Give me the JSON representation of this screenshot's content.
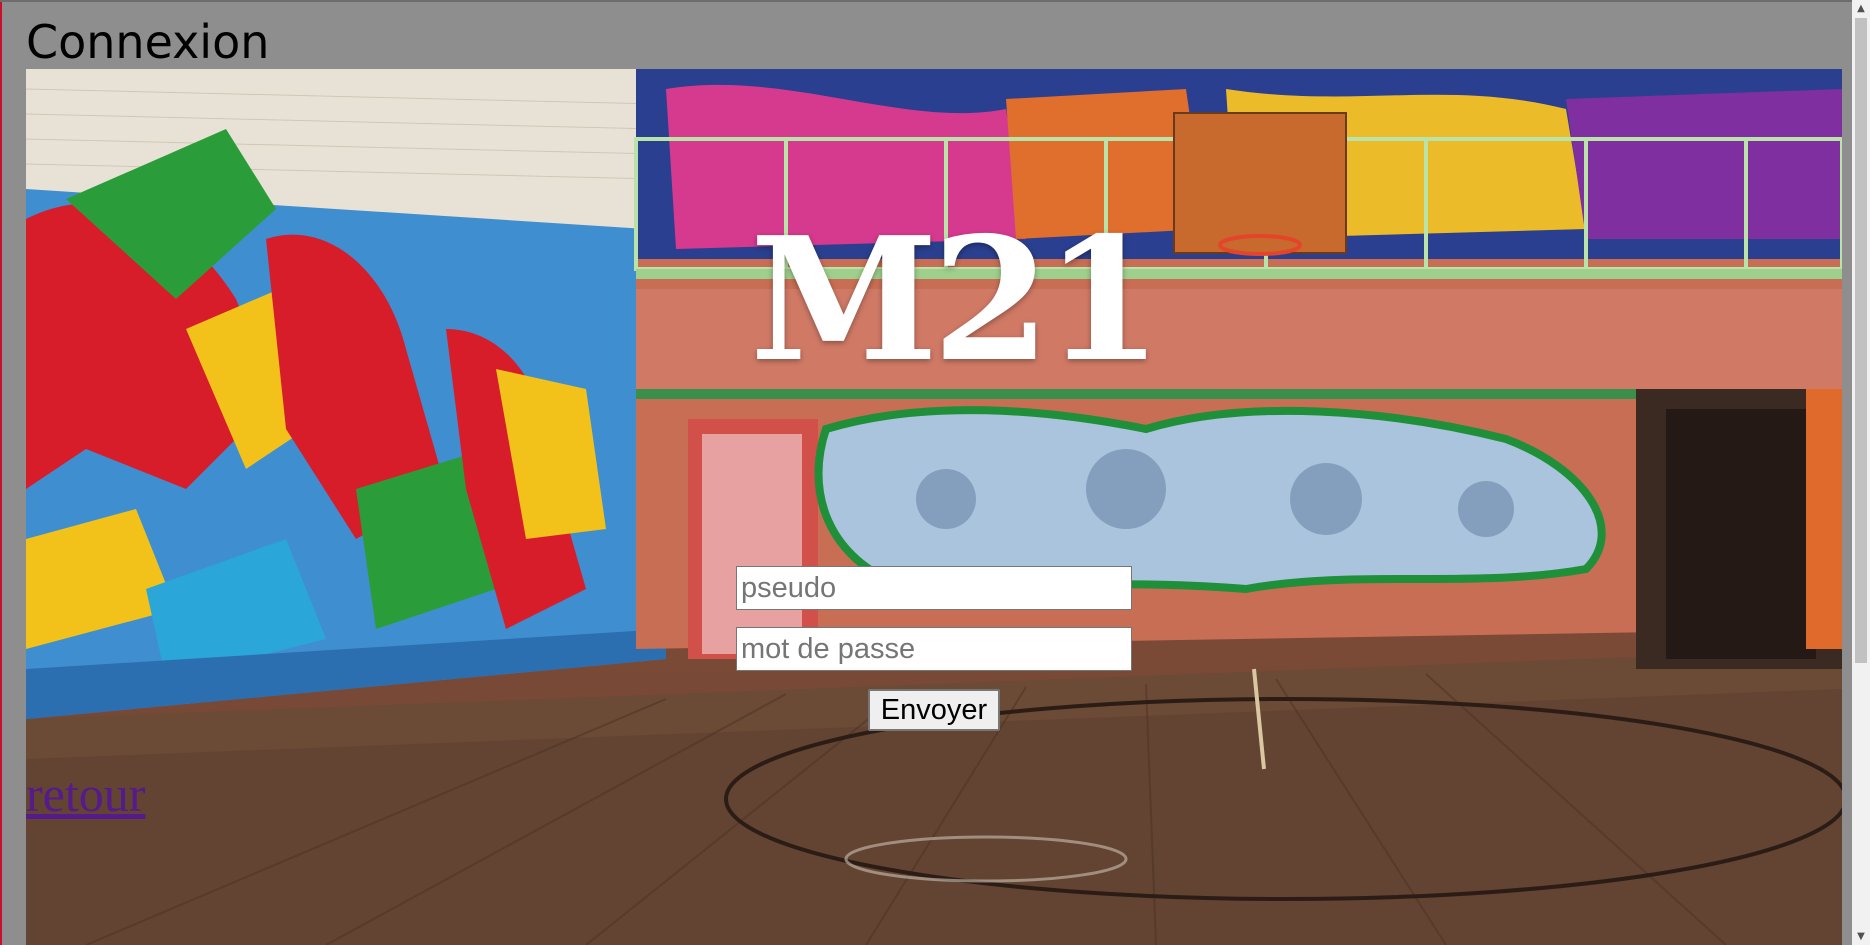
{
  "page": {
    "title": "Connexion"
  },
  "logo": {
    "text": "M21"
  },
  "form": {
    "username_placeholder": "pseudo",
    "password_placeholder": "mot de passe",
    "submit_label": "Envoyer"
  },
  "nav": {
    "back_label": "retour"
  },
  "colors": {
    "page_background": "#8e8e8e",
    "link_visited": "#551a8b",
    "logo_text": "#ffffff"
  }
}
